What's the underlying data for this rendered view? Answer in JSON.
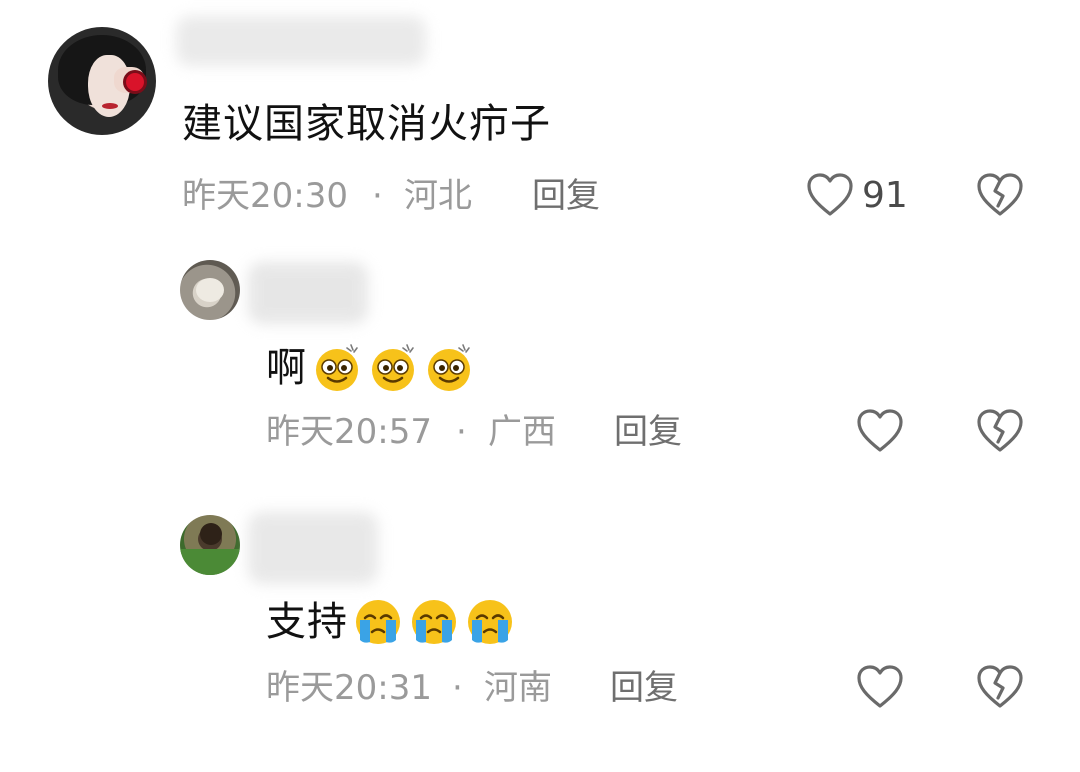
{
  "comments": [
    {
      "text": "建议国家取消火疖子",
      "time": "昨天20:30",
      "separator": "·",
      "location": "河北",
      "reply_label": "回复",
      "like_count": "91",
      "emojis": []
    },
    {
      "text": "啊",
      "time": "昨天20:57",
      "separator": "·",
      "location": "广西",
      "reply_label": "回复",
      "emojis": [
        "dizzy-smile-emoji",
        "dizzy-smile-emoji",
        "dizzy-smile-emoji"
      ]
    },
    {
      "text": "支持",
      "time": "昨天20:31",
      "separator": "·",
      "location": "河南",
      "reply_label": "回复",
      "emojis": [
        "crying-emoji",
        "crying-emoji",
        "crying-emoji"
      ]
    }
  ],
  "icons": {
    "like": "heart-outline-icon",
    "dislike": "broken-heart-icon"
  },
  "colors": {
    "text": "#111111",
    "meta": "#9a9a9a",
    "icon": "#6a6a6a",
    "emoji_yellow": "#f7c21a",
    "emoji_tear": "#3aa3e6"
  }
}
